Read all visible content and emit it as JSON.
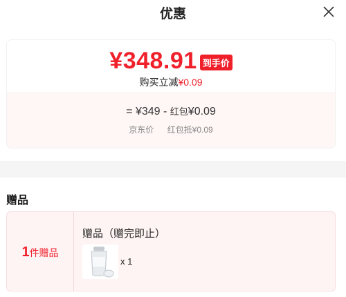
{
  "header": {
    "title": "优惠"
  },
  "price_card": {
    "final_price": "¥348.91",
    "final_tag": "到手价",
    "discount_prefix": "购买立减",
    "discount_value": "¥0.09",
    "formula_eq": "=",
    "jd_price": "¥349",
    "minus": "-",
    "red_packet_label": "红包",
    "red_packet_value": "¥0.09",
    "jd_price_label": "京东价",
    "red_packet_deduct_label": "红包抵¥0.09"
  },
  "gifts": {
    "section_title": "赠品",
    "count_number": "1",
    "count_suffix": "件赠品",
    "gift_name": "赠品（赠完即止）",
    "quantity": "x 1",
    "icon": "shaker-bottle-icon"
  },
  "colors": {
    "accent": "#f0202b",
    "card_tint": "#fff6f6"
  }
}
